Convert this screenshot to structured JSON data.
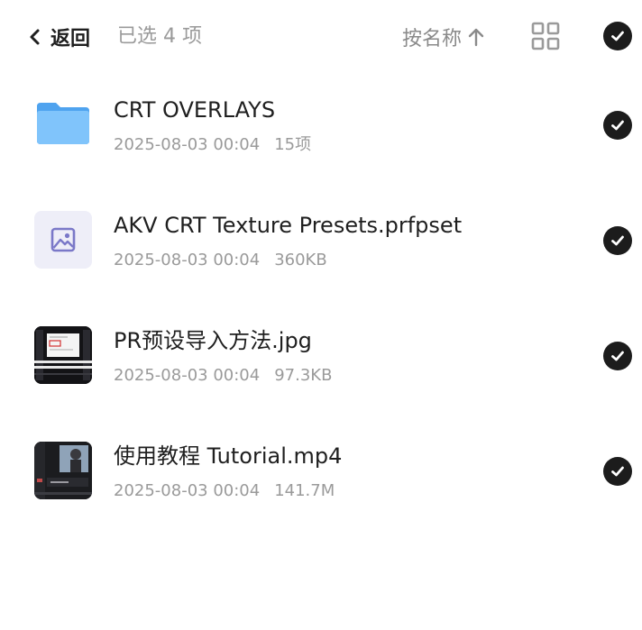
{
  "header": {
    "back_label": "返回",
    "selected_text": "已选 4 项",
    "sort_label": "按名称"
  },
  "icons": {
    "back": "chevron-left-icon",
    "sort": "arrow-up-icon",
    "view": "grid-view-icon",
    "check": "check-circle-icon"
  },
  "colors": {
    "check_fill": "#1c1c1c",
    "folder": "#5aaef4",
    "preset_icon": "#7a78c8"
  },
  "files": [
    {
      "name": "CRT OVERLAYS",
      "date": "2025-08-03 00:04",
      "size": "15项",
      "type": "folder",
      "selected": true
    },
    {
      "name": "AKV CRT Texture Presets.prfpset",
      "date": "2025-08-03 00:04",
      "size": "360KB",
      "type": "preset",
      "selected": true
    },
    {
      "name": "PR预设导入方法.jpg",
      "date": "2025-08-03 00:04",
      "size": "97.3KB",
      "type": "image",
      "selected": true
    },
    {
      "name": "使用教程 Tutorial.mp4",
      "date": "2025-08-03 00:04",
      "size": "141.7M",
      "type": "video",
      "selected": true
    }
  ]
}
